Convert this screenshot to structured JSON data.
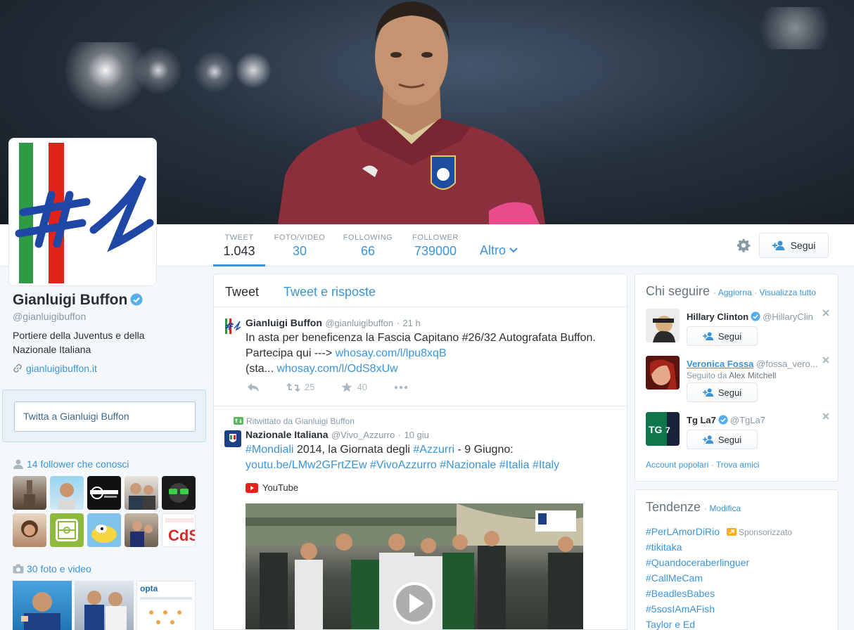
{
  "profile": {
    "name": "Gianluigi Buffon",
    "handle": "@gianluigibuffon",
    "bio": "Portiere della Juventus e della Nazionale Italiana",
    "website": "gianluigibuffon.it",
    "avatar_text": "#1"
  },
  "nav": {
    "stats": [
      {
        "label": "TWEET",
        "value": "1.043"
      },
      {
        "label": "FOTO/VIDEO",
        "value": "30"
      },
      {
        "label": "FOLLOWING",
        "value": "66"
      },
      {
        "label": "FOLLOWER",
        "value": "739000"
      }
    ],
    "more_label": "Altro",
    "follow_label": "Segui"
  },
  "sidebar": {
    "tweet_to_placeholder": "Twitta a Gianluigi Buffon",
    "followers_you_know": "14 follower che conosci",
    "photos_videos": "30 foto e video"
  },
  "timeline": {
    "tabs": [
      "Tweet",
      "Tweet e risposte"
    ],
    "tweets": [
      {
        "name": "Gianluigi Buffon",
        "handle": "@gianluigibuffon",
        "time": "21 h",
        "text_1": "In asta per beneficenza la Fascia Capitano #26/32 Autografata Buffon.",
        "text_2": "Partecipa qui --->",
        "link_1": "whosay.com/l/lpu8xqB",
        "text_3": "(sta...",
        "link_2": "whosay.com/l/OdS8xUw",
        "retweets": "25",
        "favorites": "40"
      },
      {
        "retweeted_by": "Ritwittato da Gianluigi Buffon",
        "name": "Nazionale Italiana",
        "handle": "@Vivo_Azzurro",
        "time": "10 giu",
        "hashtag_1": "#Mondiali",
        "text_1": "2014, la Giornata degli",
        "hashtag_2": "#Azzurri",
        "text_2": "- 9 Giugno:",
        "link_1": "youtu.be/LMw2GFrtZEw",
        "hashtag_3": "#VivoAzzurro",
        "hashtag_4": "#Nazionale",
        "hashtag_5": "#Italia",
        "hashtag_6": "#Italy",
        "media_source": "YouTube"
      }
    ]
  },
  "who_to_follow": {
    "title": "Chi seguire",
    "refresh": "Aggiorna",
    "view_all": "Visualizza tutto",
    "suggestions": [
      {
        "name": "Hillary Clinton",
        "handle": "@HillaryClin",
        "follow": "Segui"
      },
      {
        "name": "Veronica Fossa",
        "handle": "@fossa_vero...",
        "followed_by_label": "Seguito da",
        "followed_by": "Alex Mitchell",
        "follow": "Segui"
      },
      {
        "name": "Tg La7",
        "handle": "@TgLa7",
        "follow": "Segui"
      }
    ],
    "footer_popular": "Account popolari",
    "footer_find": "Trova amici"
  },
  "trends": {
    "title": "Tendenze",
    "edit": "Modifica",
    "promoted_label": "Sponsorizzato",
    "items": [
      "#PerLAmorDiRio",
      "#tikitaka",
      "#Quandoceraberlinguer",
      "#CallMeCam",
      "#BeadlesBabes",
      "#5sosIAmAFish",
      "Taylor e Ed"
    ]
  },
  "colors": {
    "accent": "#3b94d9",
    "text": "#292f33",
    "muted": "#8899a6",
    "border": "#e1e8ed"
  },
  "icons": [
    "verified-badge-icon",
    "link-icon",
    "person-icon",
    "camera-icon",
    "gear-icon",
    "follow-person-icon",
    "reply-icon",
    "retweet-icon",
    "favorite-icon",
    "more-icon",
    "youtube-icon",
    "play-icon",
    "close-icon",
    "promoted-icon"
  ]
}
